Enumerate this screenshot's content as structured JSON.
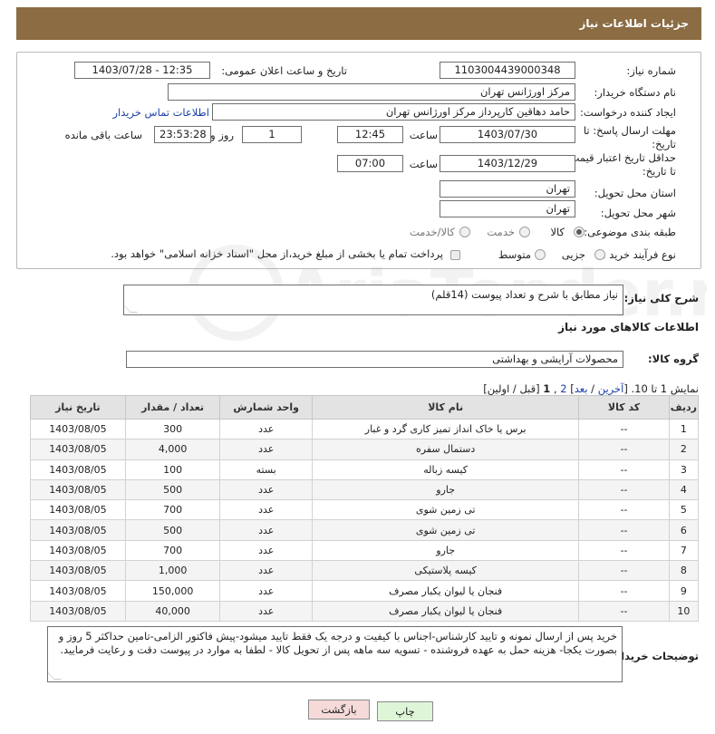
{
  "header": {
    "title": "جزئیات اطلاعات نیاز"
  },
  "form": {
    "need_number_label": "شماره نیاز:",
    "need_number": "1103004439000348",
    "announce_label": "تاریخ و ساعت اعلان عمومی:",
    "announce_value": "1403/07/28 - 12:35",
    "buyer_org_label": "نام دستگاه خریدار:",
    "buyer_org": "مرکز اورژانس تهران",
    "creator_label": "ایجاد کننده درخواست:",
    "creator": "حامد دهاقین کارپرداز مرکز اورژانس تهران",
    "contact_link": "اطلاعات تماس خریدار",
    "deadline_label": "مهلت ارسال پاسخ: تا تاریخ:",
    "deadline_date": "1403/07/30",
    "time_word": "ساعت",
    "deadline_time": "12:45",
    "days_value": "1",
    "day_and": "روز و",
    "remaining_time": "23:53:28",
    "remaining_label": "ساعت باقی مانده",
    "validity_label": "حداقل تاریخ اعتبار قیمت: تا تاریخ:",
    "validity_date": "1403/12/29",
    "validity_time": "07:00",
    "province_label": "استان محل تحویل:",
    "province": "تهران",
    "city_label": "شهر محل تحویل:",
    "city": "تهران",
    "category_label": "طبقه بندی موضوعی:",
    "category_options": [
      "کالا",
      "خدمت",
      "کالا/خدمت"
    ],
    "process_label": "نوع فرآیند خرید :",
    "process_options": [
      "جزیی",
      "متوسط"
    ],
    "treasury_note": "پرداخت تمام یا بخشی از مبلغ خرید،از محل \"اسناد خزانه اسلامی\" خواهد بود."
  },
  "summary": {
    "label": "شرح کلی نیاز:",
    "value": "نیاز مطابق با شرح و تعداد پیوست (14قلم)"
  },
  "goods_section": {
    "title": "اطلاعات کالاهای مورد نیاز",
    "group_label": "گروه کالا:",
    "group_value": "محصولات آرایشی و بهداشتی",
    "pagination": {
      "prefix": "نمایش 1 تا 10. [",
      "last": "آخرین",
      "sep1": " / ",
      "next": "بعد",
      "page2": "2",
      "comma": " ,",
      "page1": "1",
      "suffix": " [قبل / اولین]"
    }
  },
  "table": {
    "headers": [
      "ردیف",
      "کد کالا",
      "نام کالا",
      "واحد شمارش",
      "تعداد / مقدار",
      "تاریخ نیاز"
    ],
    "rows": [
      [
        "1",
        "--",
        "برس یا خاک انداز تمیز کاری گرد و غبار",
        "عدد",
        "300",
        "1403/08/05"
      ],
      [
        "2",
        "--",
        "دستمال سفره",
        "عدد",
        "4,000",
        "1403/08/05"
      ],
      [
        "3",
        "--",
        "کیسه زباله",
        "بسته",
        "100",
        "1403/08/05"
      ],
      [
        "4",
        "--",
        "جارو",
        "عدد",
        "500",
        "1403/08/05"
      ],
      [
        "5",
        "--",
        "تی زمین شوی",
        "عدد",
        "700",
        "1403/08/05"
      ],
      [
        "6",
        "--",
        "تی زمین شوی",
        "عدد",
        "500",
        "1403/08/05"
      ],
      [
        "7",
        "--",
        "جارو",
        "عدد",
        "700",
        "1403/08/05"
      ],
      [
        "8",
        "--",
        "کیسه پلاستیکی",
        "عدد",
        "1,000",
        "1403/08/05"
      ],
      [
        "9",
        "--",
        "فنجان یا لیوان یکبار مصرف",
        "عدد",
        "150,000",
        "1403/08/05"
      ],
      [
        "10",
        "--",
        "فنجان یا لیوان یکبار مصرف",
        "عدد",
        "40,000",
        "1403/08/05"
      ]
    ]
  },
  "buyer_notes": {
    "label": "توضیحات خریدار:",
    "text": "خرید پس از ارسال نمونه و تایید کارشناس-اجناس با کیفیت و درجه یک فقط تایید میشود-پیش فاکتور الزامی-تامین حداکثر 5 روز و بصورت یکجا- هزینه حمل به عهده فروشنده - تسویه سه ماهه پس از تحویل کالا - لطفا به موارد در پیوست دقت و رعایت فرمایید."
  },
  "buttons": {
    "print": "چاپ",
    "back": "بازگشت"
  },
  "watermark": "AriaTender.neT",
  "colors": {
    "header_bg": "#8b6c43",
    "link": "#1a3fa8",
    "print_btn": "#dff5d8",
    "back_btn": "#f6dada"
  }
}
